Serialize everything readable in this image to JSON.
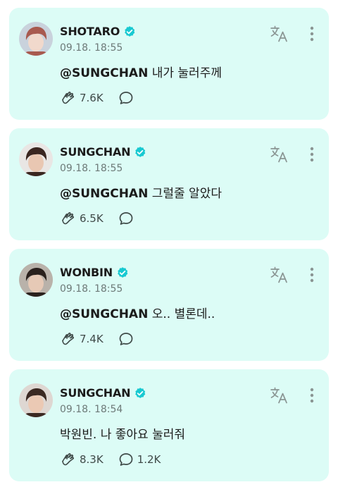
{
  "posts": [
    {
      "author": "SHOTARO",
      "timestamp": "09.18. 18:55",
      "mention": "@SUNGCHAN",
      "text": " 내가 눌러주께",
      "likes": "7.6K",
      "comments": "",
      "avatar_bg": "#c9d2dc",
      "avatar_hair": "#a85a4f",
      "avatar_skin": "#f1d9cc"
    },
    {
      "author": "SUNGCHAN",
      "timestamp": "09.18. 18:55",
      "mention": "@SUNGCHAN",
      "text": " 그럴줄 알았다",
      "likes": "6.5K",
      "comments": "",
      "avatar_bg": "#e9e6e4",
      "avatar_hair": "#3a2620",
      "avatar_skin": "#e9c7b2"
    },
    {
      "author": "WONBIN",
      "timestamp": "09.18. 18:55",
      "mention": "@SUNGCHAN",
      "text": " 오.. 별론데..",
      "likes": "7.4K",
      "comments": "",
      "avatar_bg": "#b9b2aa",
      "avatar_hair": "#2a211d",
      "avatar_skin": "#e6c9b6"
    },
    {
      "author": "SUNGCHAN",
      "timestamp": "09.18. 18:54",
      "mention": "",
      "text": "박원빈. 나 좋아요 눌러줘",
      "likes": "8.3K",
      "comments": "1.2K",
      "avatar_bg": "#ded7d2",
      "avatar_hair": "#3b2922",
      "avatar_skin": "#ebc9b4"
    }
  ],
  "colors": {
    "card_bg": "#dcfcf6",
    "verified": "#18c9d1",
    "icon_gray": "#8a9593",
    "stat_icon": "#3f4a48"
  },
  "icons": {
    "verified": "verified-badge-icon",
    "translate": "translate-icon",
    "more": "more-vertical-icon",
    "like": "like-hands-icon",
    "comment": "comment-bubble-icon"
  }
}
